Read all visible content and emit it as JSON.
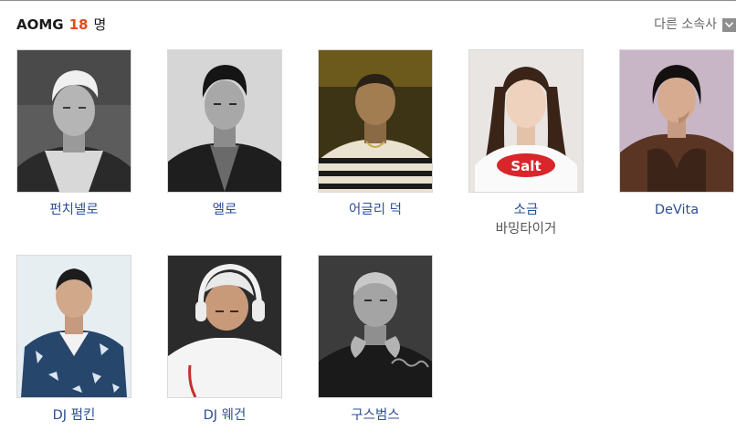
{
  "header": {
    "agency": "AOMG",
    "count": "18",
    "unit": "명",
    "other_agencies": "다른 소속사"
  },
  "artists": [
    {
      "name": "펀치넬로",
      "sub": "",
      "photo": "artist-photo-grayscale-blond"
    },
    {
      "name": "엘로",
      "sub": "",
      "photo": "artist-photo-grayscale-black-jacket"
    },
    {
      "name": "어글리 덕",
      "sub": "",
      "photo": "artist-photo-color-striped-shirt"
    },
    {
      "name": "소금",
      "sub": "바밍타이거",
      "photo": "artist-photo-color-salt-tshirt"
    },
    {
      "name": "DeVita",
      "sub": "",
      "photo": "artist-photo-color-brown-satin"
    },
    {
      "name": "DJ 펌킨",
      "sub": "",
      "photo": "artist-photo-color-camo-jacket"
    },
    {
      "name": "DJ 웨건",
      "sub": "",
      "photo": "artist-photo-color-headphones"
    },
    {
      "name": "구스범스",
      "sub": "",
      "photo": "artist-photo-grayscale-hand-gesture"
    }
  ],
  "colors": {
    "count_accent": "#e14b19",
    "link": "#2c4f97",
    "subtext": "#555555",
    "dropdown_icon_bg": "#8f8f8f"
  }
}
